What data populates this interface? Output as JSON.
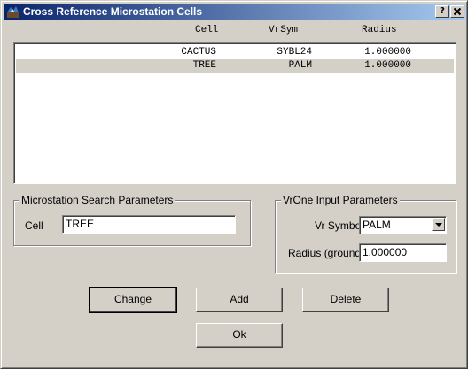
{
  "window": {
    "title": "Cross Reference Microstation Cells",
    "help_button": "?",
    "close_button": "X"
  },
  "table": {
    "columns": [
      "Cell",
      "VrSym",
      "Radius"
    ],
    "rows": [
      {
        "cell": "CACTUS",
        "vrsym": "SYBL24",
        "radius": "1.000000",
        "selected": false
      },
      {
        "cell": "TREE",
        "vrsym": "PALM",
        "radius": "1.000000",
        "selected": true
      }
    ]
  },
  "microstation_group": {
    "title": "Microstation Search Parameters",
    "cell_label": "Cell",
    "cell_value": "TREE"
  },
  "vrone_group": {
    "title": "VrOne Input Parameters",
    "symbol_label": "Vr Symbol",
    "symbol_value": "PALM",
    "radius_label": "Radius (ground)",
    "radius_value": "1.000000"
  },
  "buttons": {
    "change": "Change",
    "add": "Add",
    "delete": "Delete",
    "ok": "Ok"
  },
  "colors": {
    "titlebar_start": "#0a246a",
    "titlebar_end": "#a6caf0",
    "face": "#d4d0c8"
  }
}
